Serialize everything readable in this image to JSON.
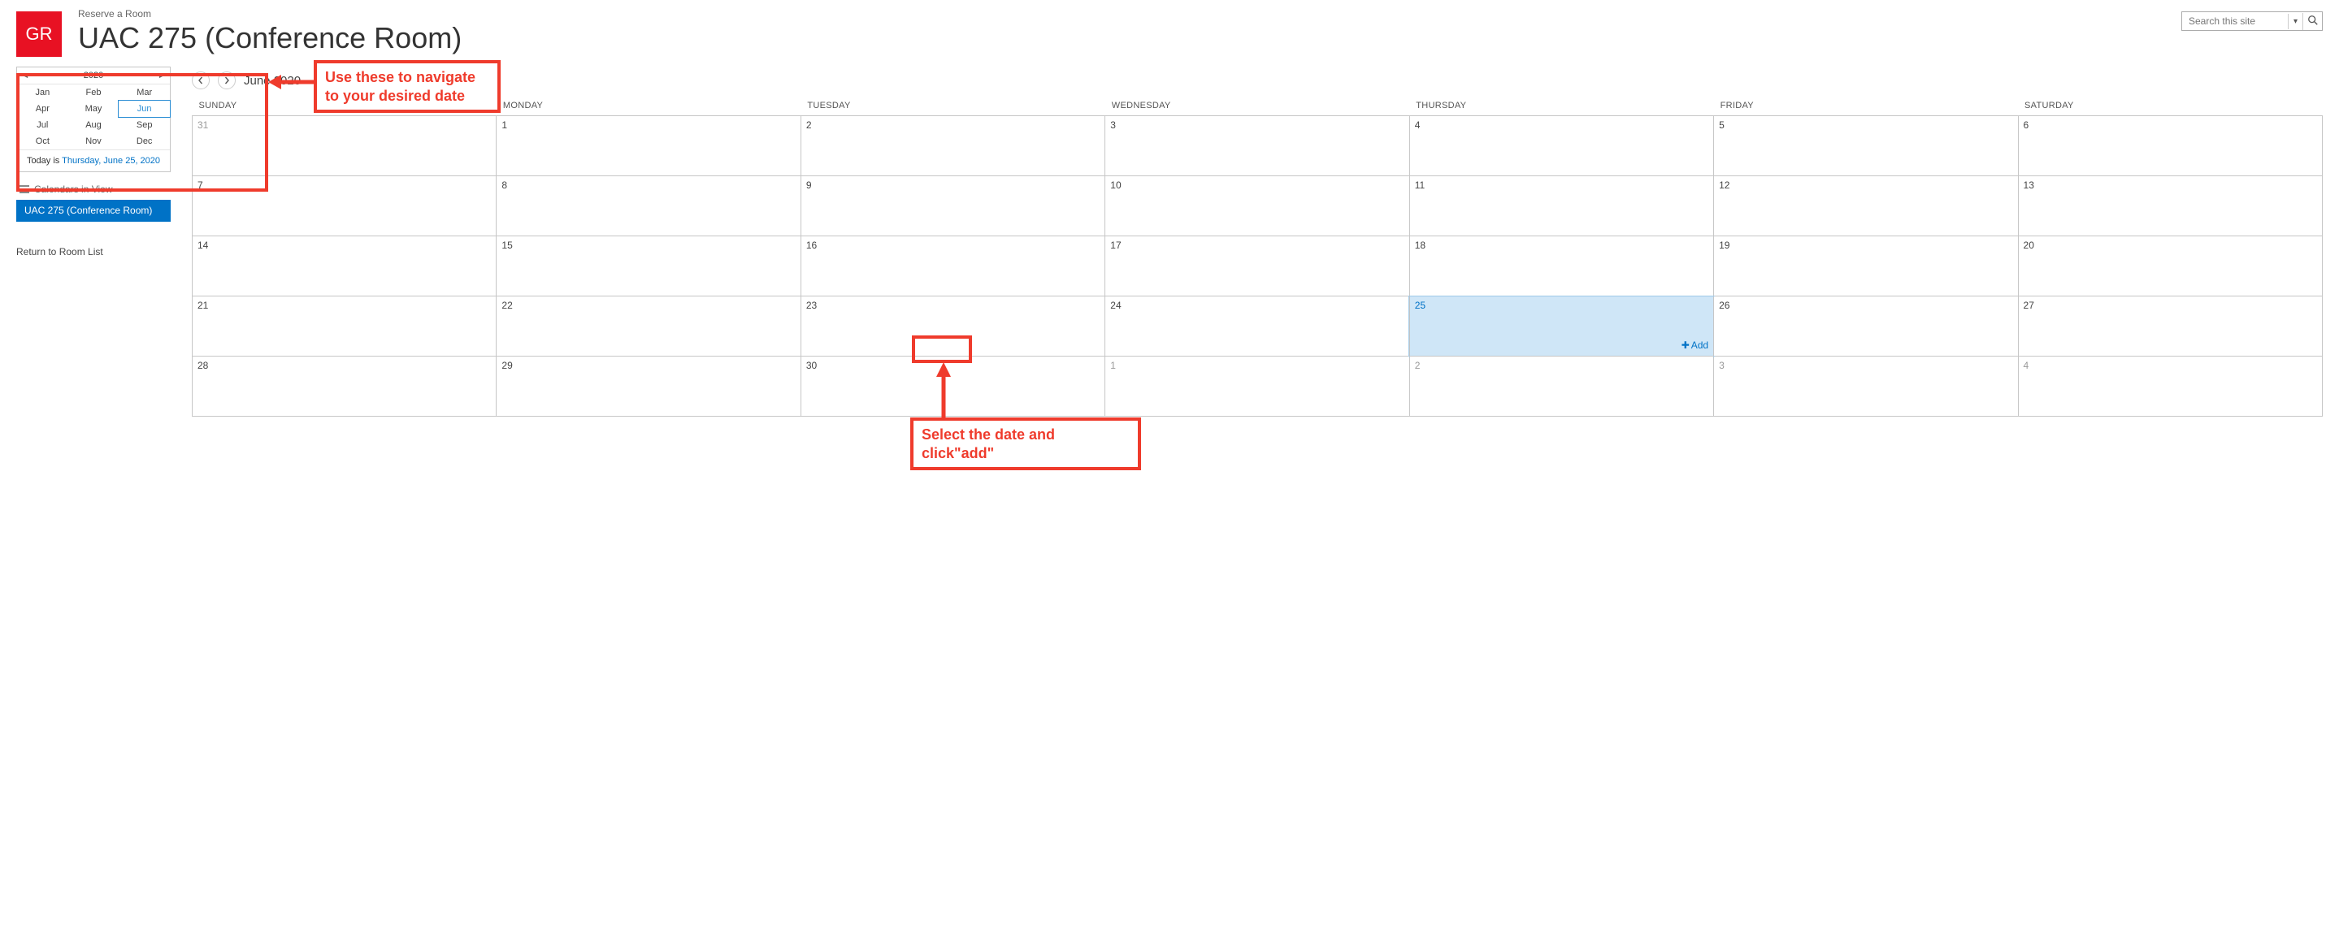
{
  "header": {
    "logo_text": "GR",
    "breadcrumb": "Reserve a Room",
    "title": "UAC 275 (Conference Room)"
  },
  "search": {
    "placeholder": "Search this site"
  },
  "mini_month": {
    "year": "2020",
    "months": [
      "Jan",
      "Feb",
      "Mar",
      "Apr",
      "May",
      "Jun",
      "Jul",
      "Aug",
      "Sep",
      "Oct",
      "Nov",
      "Dec"
    ],
    "selected_index": 5,
    "today_prefix": "Today is ",
    "today_link": "Thursday, June 25, 2020"
  },
  "calendars_in_view": {
    "label": "Calendars in View",
    "item": "UAC 275 (Conference Room)"
  },
  "return_link": "Return to Room List",
  "cal_nav": {
    "label": "June 2020"
  },
  "day_headers": [
    "SUNDAY",
    "MONDAY",
    "TUESDAY",
    "WEDNESDAY",
    "THURSDAY",
    "FRIDAY",
    "SATURDAY"
  ],
  "weeks": [
    [
      {
        "n": "31",
        "other": true
      },
      {
        "n": "1"
      },
      {
        "n": "2"
      },
      {
        "n": "3"
      },
      {
        "n": "4"
      },
      {
        "n": "5"
      },
      {
        "n": "6"
      }
    ],
    [
      {
        "n": "7"
      },
      {
        "n": "8"
      },
      {
        "n": "9"
      },
      {
        "n": "10"
      },
      {
        "n": "11"
      },
      {
        "n": "12"
      },
      {
        "n": "13"
      }
    ],
    [
      {
        "n": "14"
      },
      {
        "n": "15"
      },
      {
        "n": "16"
      },
      {
        "n": "17"
      },
      {
        "n": "18"
      },
      {
        "n": "19"
      },
      {
        "n": "20"
      }
    ],
    [
      {
        "n": "21"
      },
      {
        "n": "22"
      },
      {
        "n": "23"
      },
      {
        "n": "24"
      },
      {
        "n": "25",
        "today": true
      },
      {
        "n": "26"
      },
      {
        "n": "27"
      }
    ],
    [
      {
        "n": "28"
      },
      {
        "n": "29"
      },
      {
        "n": "30"
      },
      {
        "n": "1",
        "other": true
      },
      {
        "n": "2",
        "other": true
      },
      {
        "n": "3",
        "other": true
      },
      {
        "n": "4",
        "other": true
      }
    ]
  ],
  "add_label": "Add",
  "annotations": {
    "nav_label": "Use these to navigate to your desired date",
    "add_label": "Select the date and click\"add\""
  }
}
